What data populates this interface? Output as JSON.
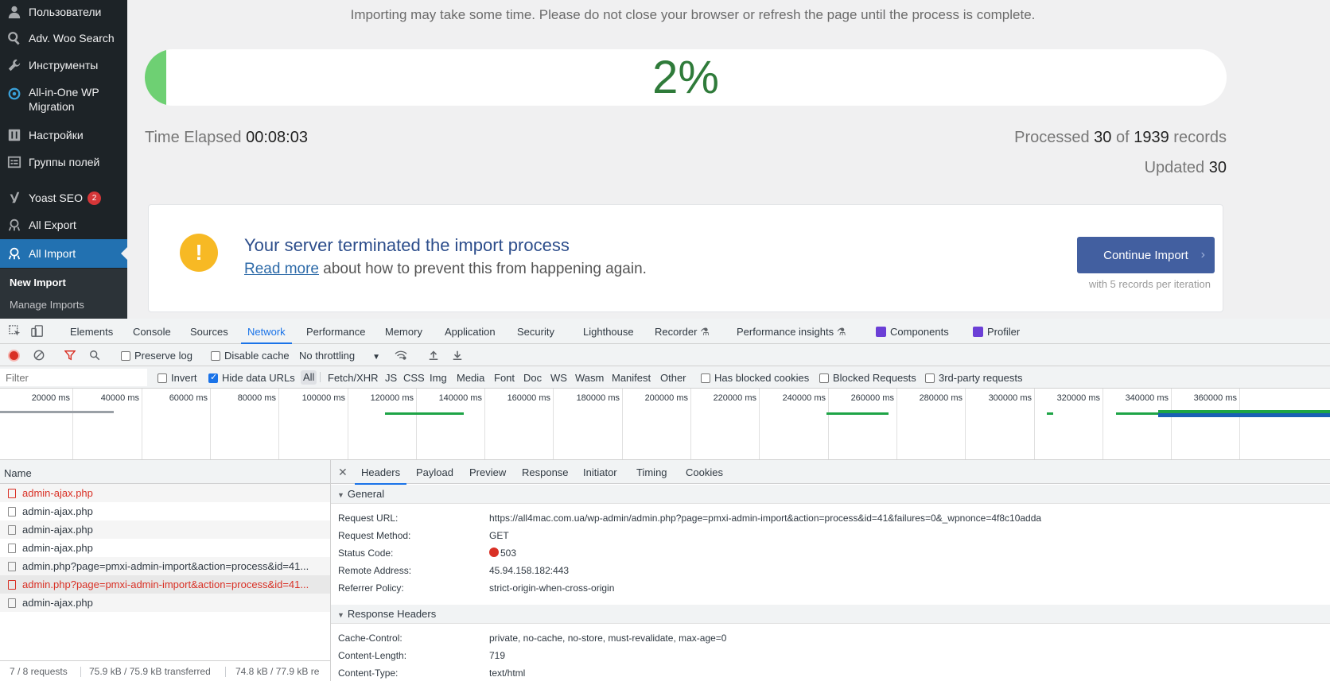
{
  "sidebar": {
    "items": [
      {
        "label": "Пользователи",
        "icon": "user-icon"
      },
      {
        "label": "Adv. Woo Search",
        "icon": "search-icon"
      },
      {
        "label": "Инструменты",
        "icon": "wrench-icon"
      },
      {
        "label": "All-in-One WP Migration",
        "icon": "migration-icon"
      },
      {
        "label": "Настройки",
        "icon": "settings-sliders-icon"
      },
      {
        "label": "Группы полей",
        "icon": "field-groups-icon"
      },
      {
        "label": "Yoast SEO",
        "icon": "yoast-icon",
        "badge": "2"
      },
      {
        "label": "All Export",
        "icon": "export-icon"
      },
      {
        "label": "All Import",
        "icon": "import-icon"
      }
    ],
    "submenu": [
      {
        "label": "New Import"
      },
      {
        "label": "Manage Imports"
      }
    ]
  },
  "import": {
    "notice": "Importing may take some time. Please do not close your browser or refresh the page until the process is complete.",
    "progress_text": "2%",
    "progress_fraction": 0.02,
    "elapsed_label": "Time Elapsed",
    "elapsed_value": "00:08:03",
    "processed_label": "Processed",
    "processed_count": "30",
    "of_label": "of",
    "total_count": "1939",
    "records_label": "records",
    "updated_label": "Updated",
    "updated_count": "30",
    "error_title": "Your server terminated the import process",
    "read_more": "Read more",
    "error_sub": " about how to prevent this from happening again.",
    "continue_label": "Continue Import",
    "iteration_note": "with 5 records per iteration"
  },
  "devtools": {
    "tabs": [
      "Elements",
      "Console",
      "Sources",
      "Network",
      "Performance",
      "Memory",
      "Application",
      "Security",
      "Lighthouse",
      "Recorder",
      "Performance insights",
      "Components",
      "Profiler"
    ],
    "active_tab": "Network",
    "toolbar": {
      "preserve_log": "Preserve log",
      "disable_cache": "Disable cache",
      "throttling": "No throttling"
    },
    "filter": {
      "placeholder": "Filter",
      "invert": "Invert",
      "hide_data_urls": "Hide data URLs",
      "types": [
        "All",
        "Fetch/XHR",
        "JS",
        "CSS",
        "Img",
        "Media",
        "Font",
        "Doc",
        "WS",
        "Wasm",
        "Manifest",
        "Other"
      ],
      "has_blocked_cookies": "Has blocked cookies",
      "blocked_requests": "Blocked Requests",
      "third_party": "3rd-party requests"
    },
    "timeline_ticks": [
      "20000 ms",
      "40000 ms",
      "60000 ms",
      "80000 ms",
      "100000 ms",
      "120000 ms",
      "140000 ms",
      "160000 ms",
      "180000 ms",
      "200000 ms",
      "220000 ms",
      "240000 ms",
      "260000 ms",
      "280000 ms",
      "300000 ms",
      "320000 ms",
      "340000 ms",
      "360000 ms"
    ],
    "colors": {
      "timeline_green": "#1ea446",
      "timeline_blue": "#1a5fb4",
      "timeline_grey": "#9aa0a6",
      "error": "#d93025",
      "accent": "#1a73e8"
    },
    "requests": {
      "header": "Name",
      "rows": [
        {
          "name": "admin-ajax.php",
          "error": true
        },
        {
          "name": "admin-ajax.php",
          "error": false
        },
        {
          "name": "admin-ajax.php",
          "error": false
        },
        {
          "name": "admin-ajax.php",
          "error": false
        },
        {
          "name": "admin.php?page=pmxi-admin-import&action=process&id=41...",
          "error": false
        },
        {
          "name": "admin.php?page=pmxi-admin-import&action=process&id=41...",
          "error": true
        },
        {
          "name": "admin-ajax.php",
          "error": false
        }
      ],
      "status_requests": "7 / 8 requests",
      "status_transferred": "75.9 kB / 75.9 kB transferred",
      "status_resources": "74.8 kB / 77.9 kB re"
    },
    "details": {
      "tabs": [
        "Headers",
        "Payload",
        "Preview",
        "Response",
        "Initiator",
        "Timing",
        "Cookies"
      ],
      "general_title": "General",
      "general": [
        {
          "key": "Request URL:",
          "value": "https://all4mac.com.ua/wp-admin/admin.php?page=pmxi-admin-import&action=process&id=41&failures=0&_wpnonce=4f8c10adda"
        },
        {
          "key": "Request Method:",
          "value": "GET"
        },
        {
          "key": "Status Code:",
          "value": "503"
        },
        {
          "key": "Remote Address:",
          "value": "45.94.158.182:443"
        },
        {
          "key": "Referrer Policy:",
          "value": "strict-origin-when-cross-origin"
        }
      ],
      "response_title": "Response Headers",
      "response": [
        {
          "key": "Cache-Control:",
          "value": "private, no-cache, no-store, must-revalidate, max-age=0"
        },
        {
          "key": "Content-Length:",
          "value": "719"
        },
        {
          "key": "Content-Type:",
          "value": "text/html"
        }
      ]
    }
  }
}
